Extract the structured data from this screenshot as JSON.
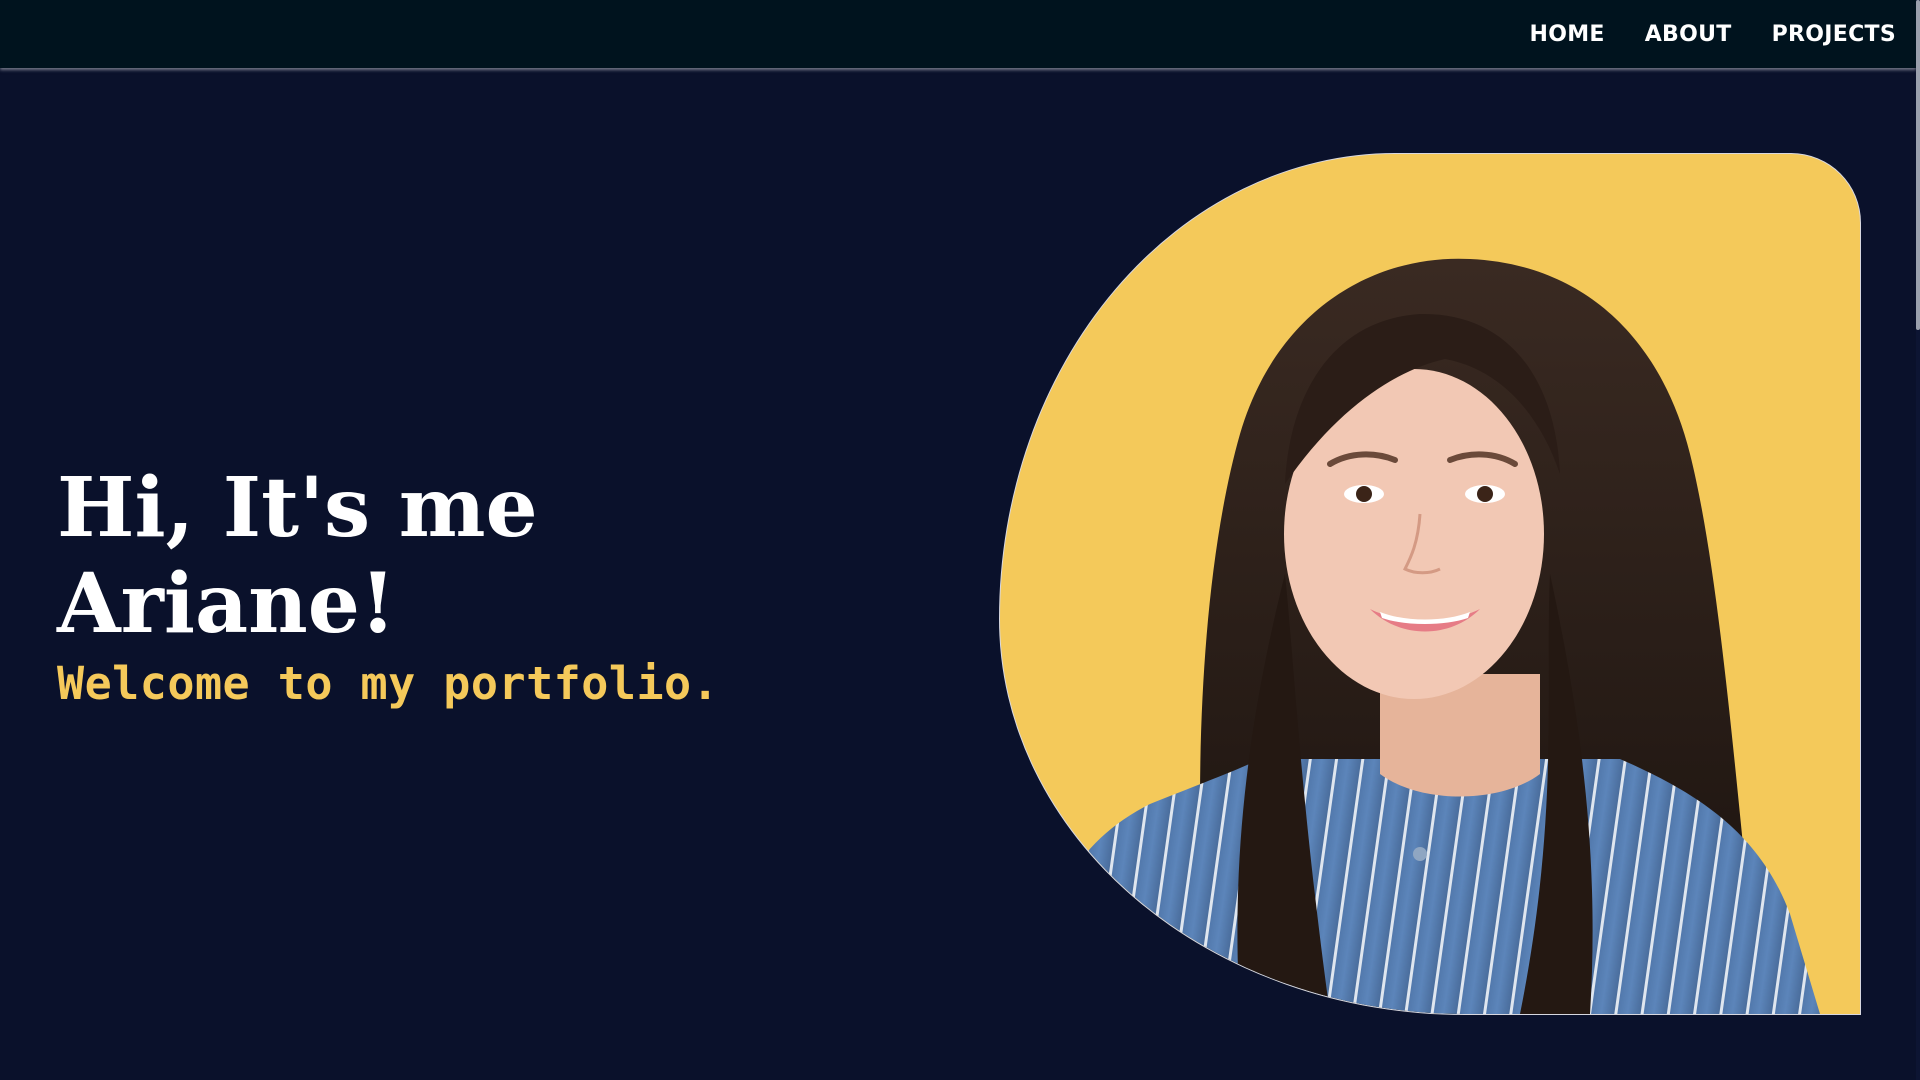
{
  "nav": {
    "links": [
      "HOME",
      "ABOUT",
      "PROJECTS"
    ]
  },
  "hero": {
    "heading": "Hi, It's me Ariane!",
    "subtitle": "Welcome to my portfolio."
  },
  "portrait": {
    "icon": "profile-photo",
    "background_color": "#f4c95a"
  },
  "colors": {
    "page_background": "#0a112b",
    "navbar_background": "#00131e",
    "accent": "#f5c95a",
    "text": "#ffffff"
  }
}
